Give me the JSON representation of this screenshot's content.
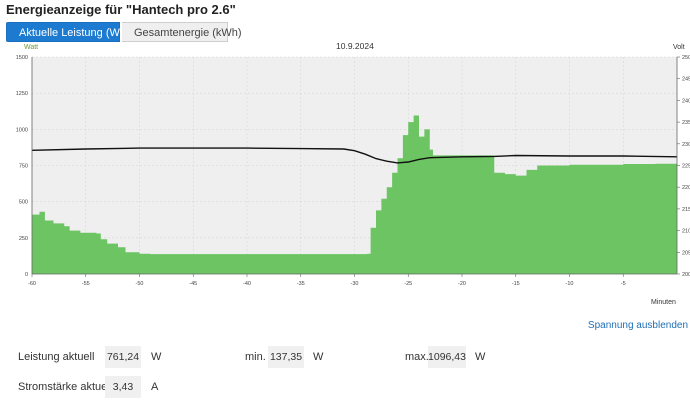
{
  "page": {
    "title": "Energieanzeige für \"Hantech pro 2.6\""
  },
  "tabs": [
    {
      "label": "Aktuelle Leistung (Watt)",
      "active": true
    },
    {
      "label": "Gesamtenergie (kWh)",
      "active": false
    }
  ],
  "chart": {
    "date": "10.9.2024",
    "left_unit": "Watt",
    "right_unit": "Volt",
    "x_unit": "Minuten",
    "left_ticks": [
      "0",
      "250",
      "500",
      "750",
      "1000",
      "1250",
      "1500"
    ],
    "right_ticks": [
      "200",
      "205",
      "210",
      "215",
      "220",
      "225",
      "230",
      "235",
      "240",
      "245",
      "250"
    ],
    "x_ticks": [
      "-60",
      "-55",
      "-50",
      "-45",
      "-40",
      "-35",
      "-30",
      "-25",
      "-20",
      "-15",
      "-10",
      "-5"
    ]
  },
  "chart_data": {
    "type": "area",
    "xlabel": "Minuten",
    "ylabel": "Watt",
    "y2label": "Volt",
    "xlim": [
      -60,
      0
    ],
    "ylim": [
      0,
      1500
    ],
    "y2lim": [
      200,
      250
    ],
    "grid": true,
    "series": [
      {
        "type": "area",
        "axis": "left",
        "color": "#6cc463",
        "points": [
          [
            -60,
            410
          ],
          [
            -59.3,
            430
          ],
          [
            -58.8,
            370
          ],
          [
            -58,
            350
          ],
          [
            -57,
            330
          ],
          [
            -56.5,
            300
          ],
          [
            -55.5,
            285
          ],
          [
            -54,
            280
          ],
          [
            -53.6,
            240
          ],
          [
            -53,
            210
          ],
          [
            -52,
            185
          ],
          [
            -51.3,
            150
          ],
          [
            -50,
            140
          ],
          [
            -49,
            137
          ],
          [
            -45,
            137
          ],
          [
            -40,
            137
          ],
          [
            -35,
            137
          ],
          [
            -30,
            137
          ],
          [
            -28.8,
            140
          ],
          [
            -28.5,
            320
          ],
          [
            -28,
            440
          ],
          [
            -27.5,
            520
          ],
          [
            -27,
            600
          ],
          [
            -26.5,
            700
          ],
          [
            -26,
            800
          ],
          [
            -25.5,
            960
          ],
          [
            -25,
            1050
          ],
          [
            -24.5,
            1096
          ],
          [
            -24,
            950
          ],
          [
            -23.5,
            1000
          ],
          [
            -23,
            860
          ],
          [
            -22.7,
            820
          ],
          [
            -22,
            820
          ],
          [
            -20,
            820
          ],
          [
            -18,
            820
          ],
          [
            -17.5,
            820
          ],
          [
            -17,
            700
          ],
          [
            -16,
            690
          ],
          [
            -15,
            680
          ],
          [
            -14,
            720
          ],
          [
            -13,
            750
          ],
          [
            -10,
            755
          ],
          [
            -5,
            760
          ],
          [
            -2,
            762
          ],
          [
            0,
            761
          ]
        ]
      },
      {
        "type": "line",
        "axis": "right",
        "color": "#111111",
        "points": [
          [
            -60,
            228.5
          ],
          [
            -55,
            228.8
          ],
          [
            -50,
            229.0
          ],
          [
            -45,
            229.0
          ],
          [
            -40,
            229.0
          ],
          [
            -35,
            228.9
          ],
          [
            -31,
            228.8
          ],
          [
            -30,
            228.4
          ],
          [
            -29,
            227.6
          ],
          [
            -28,
            226.6
          ],
          [
            -27,
            226.0
          ],
          [
            -26,
            225.6
          ],
          [
            -25,
            225.8
          ],
          [
            -24,
            226.4
          ],
          [
            -23,
            226.8
          ],
          [
            -20,
            227.0
          ],
          [
            -17,
            227.1
          ],
          [
            -15,
            227.3
          ],
          [
            -10,
            227.2
          ],
          [
            -5,
            227.2
          ],
          [
            0,
            227.0
          ]
        ]
      }
    ]
  },
  "actions": {
    "toggle_voltage": "Spannung ausblenden"
  },
  "stats": {
    "power_label": "Leistung aktuell",
    "power_value": "761,24",
    "power_unit": "W",
    "min_label": "min.",
    "min_value": "137,35",
    "min_unit": "W",
    "max_label": "max.",
    "max_value": "1096,43",
    "max_unit": "W",
    "current_label": "Stromstärke aktuell",
    "current_value": "3,43",
    "current_unit": "A"
  },
  "colors": {
    "accent": "#1c7ad0",
    "area": "#6cc463",
    "line": "#111111",
    "plot_bg": "#efefef",
    "link": "#1f6fb5"
  }
}
